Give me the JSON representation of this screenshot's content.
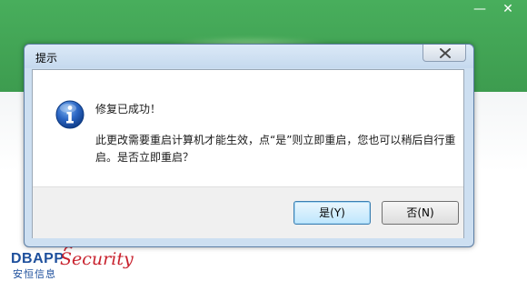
{
  "background_app": {
    "header_color": "#46aa5a",
    "minimize_glyph": "—",
    "close_glyph": "✕"
  },
  "logo": {
    "brand": "DBAPP",
    "brand_script": "ecurity",
    "brand_script_initial": "S",
    "chinese_name": "安恒信息",
    "colors": {
      "primary": "#1d4f9c",
      "accent": "#c8212d"
    }
  },
  "dialog": {
    "title": "提示",
    "icon": "info-icon",
    "message_title": "修复已成功！",
    "message_body": "此更改需要重启计算机才能生效，点“是”则立即重启，您也可以稍后自行重启。是否立即重启？",
    "buttons": {
      "yes_label": "是(Y)",
      "no_label": "否(N)"
    }
  }
}
